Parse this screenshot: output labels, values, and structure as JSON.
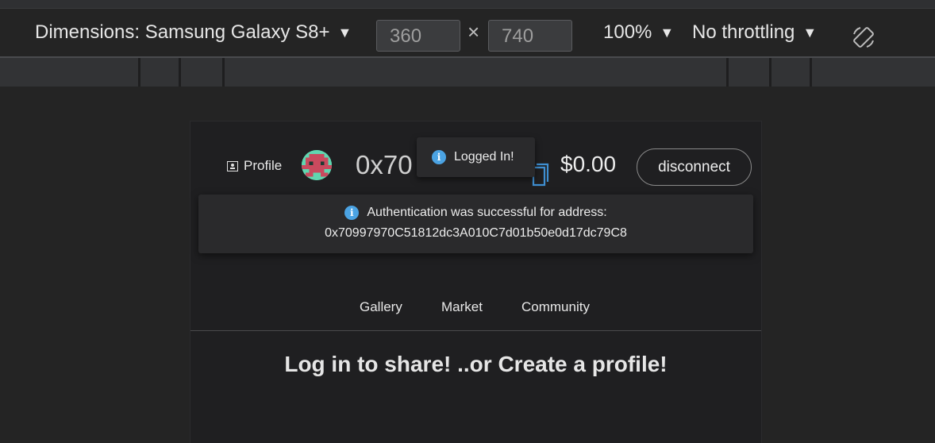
{
  "toolbar": {
    "dimensions_label": "Dimensions: Samsung Galaxy S8+",
    "width_value": "360",
    "times_symbol": "×",
    "height_value": "740",
    "zoom": "100%",
    "throttling": "No throttling",
    "caret": "▼",
    "rotate_icon": "rotate-icon"
  },
  "header": {
    "profile_label": "Profile",
    "address_short": "0x70",
    "balance": "$0.00",
    "disconnect_label": "disconnect"
  },
  "toast": {
    "icon": "i",
    "message": "Logged In!"
  },
  "notice": {
    "icon": "i",
    "line1": "Authentication was successful for address:",
    "line2": "0x70997970C51812dc3A010C7d01b50e0d17dc79C8"
  },
  "nav": {
    "items": [
      "Gallery",
      "Market",
      "Community"
    ]
  },
  "main": {
    "headline": "Log in to share! ..or Create a profile!"
  },
  "colors": {
    "info_blue": "#4ba3e3",
    "copy_icon_blue": "#3f8fd1",
    "avatar_teal": "#60d6b0",
    "avatar_red": "#c94a5e"
  }
}
